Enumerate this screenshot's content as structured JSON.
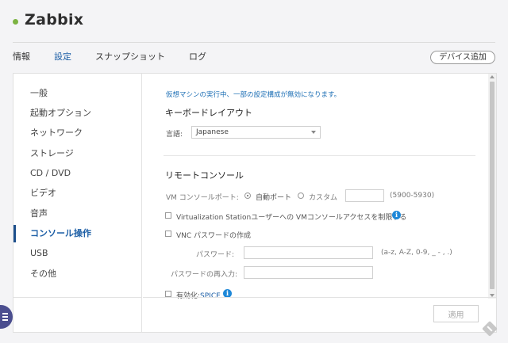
{
  "header": {
    "vm_name": "Zabbix",
    "status_color": "#7cb342"
  },
  "tabs": [
    {
      "label": "情報",
      "active": false
    },
    {
      "label": "設定",
      "active": true
    },
    {
      "label": "スナップショット",
      "active": false
    },
    {
      "label": "ログ",
      "active": false
    }
  ],
  "actions": {
    "add_device": "デバイス追加",
    "apply": "適用"
  },
  "sidebar": {
    "items": [
      {
        "label": "一般"
      },
      {
        "label": "起動オプション"
      },
      {
        "label": "ネットワーク"
      },
      {
        "label": "ストレージ"
      },
      {
        "label": "CD / DVD"
      },
      {
        "label": "ビデオ"
      },
      {
        "label": "音声"
      },
      {
        "label": "コンソール操作"
      },
      {
        "label": "USB"
      },
      {
        "label": "その他"
      }
    ],
    "active_index": 7
  },
  "content": {
    "warning": "仮想マシンの実行中、一部の設定構成が無効になります。",
    "keyboard": {
      "title": "キーボードレイアウト",
      "language_label": "言語:",
      "language_value": "Japanese"
    },
    "remote": {
      "title": "リモートコンソール",
      "port_label": "VM コンソールポート:",
      "auto_port": "自動ポート",
      "custom": "カスタム",
      "port_range": "(5900-5930)",
      "restrict_label": "Virtualization Stationユーザーへの VMコンソールアクセスを制限する",
      "vnc_password_label": "VNC パスワードの作成",
      "password_label": "パスワード:",
      "password_hint": "(a-z, A-Z, 0-9, _ - , .)",
      "password_confirm_label": "パスワードの再入力:",
      "spice_prefix": "有効化:",
      "spice_link": "SPICE"
    }
  },
  "colors": {
    "accent": "#1d5fa6",
    "info": "#1f88d8",
    "fab": "#4b4e8f"
  }
}
